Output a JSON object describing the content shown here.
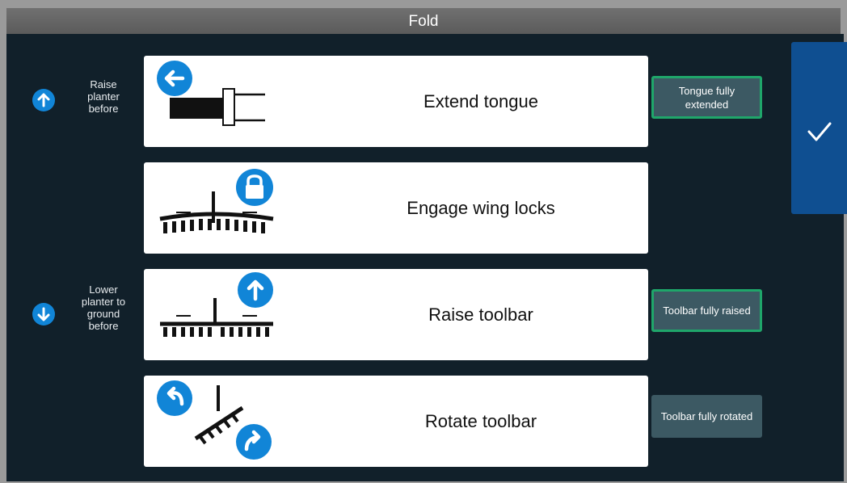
{
  "window": {
    "title": "Fold"
  },
  "notes": {
    "raise_before": "Raise\nplanter\nbefore",
    "lower_before": "Lower\nplanter to\nground\nbefore"
  },
  "steps": [
    {
      "label": "Extend tongue",
      "icon": "arrow-left-icon",
      "status": "Tongue fully extended",
      "status_done": true
    },
    {
      "label": "Engage wing locks",
      "icon": "lock-icon",
      "status": "",
      "status_done": false
    },
    {
      "label": "Raise toolbar",
      "icon": "arrow-up-icon",
      "status": "Toolbar fully raised",
      "status_done": true
    },
    {
      "label": "Rotate toolbar",
      "icon": "rotate-icons",
      "status": "Toolbar fully rotated",
      "status_done": false
    }
  ],
  "confirm": {
    "icon": "checkmark-icon"
  },
  "colors": {
    "background": "#11202a",
    "accent": "#1185d7",
    "status_bg": "#3c5963",
    "status_done_border": "#1fa66a",
    "confirm_bg": "#0f4f91"
  }
}
